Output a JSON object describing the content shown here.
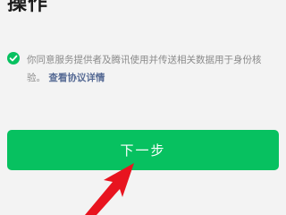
{
  "page": {
    "title": "操作"
  },
  "consent": {
    "text": "你同意服务提供者及腾讯使用并传送相关数据用于身份核验。",
    "link_label": "查看协议详情",
    "checked": true
  },
  "actions": {
    "next_label": "下一步"
  },
  "colors": {
    "primary": "#07c160",
    "link": "#576b95",
    "annotation_arrow": "#e8141f"
  },
  "icons": {
    "checkbox": "check-circle-icon",
    "annotation": "red-arrow-icon"
  }
}
